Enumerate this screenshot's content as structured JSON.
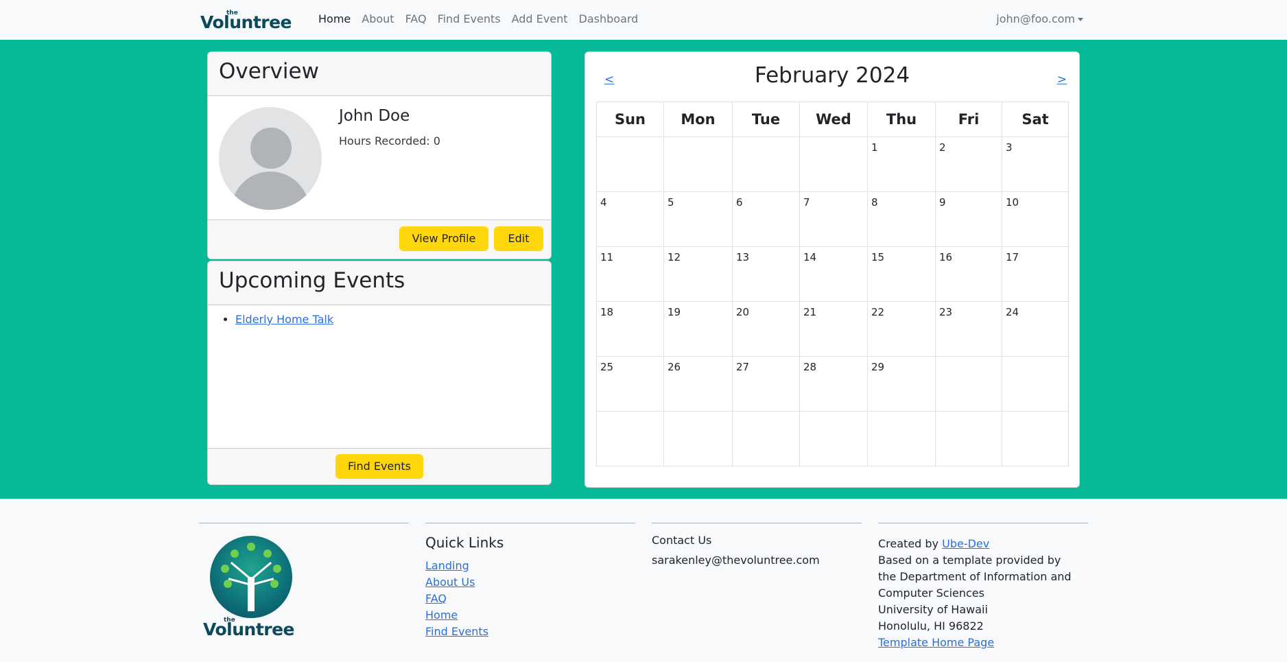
{
  "navbar": {
    "brand_the": "the",
    "brand_word": "Voluntree",
    "links": [
      "Home",
      "About",
      "FAQ",
      "Find Events",
      "Add Event",
      "Dashboard"
    ],
    "user_email": "john@foo.com"
  },
  "overview": {
    "title": "Overview",
    "name": "John Doe",
    "hours": "Hours Recorded: 0",
    "view_profile_label": "View Profile",
    "edit_label": "Edit"
  },
  "upcoming": {
    "title": "Upcoming Events",
    "events": [
      "Elderly Home Talk"
    ],
    "find_events_label": "Find Events"
  },
  "calendar": {
    "title": "February 2024",
    "prev_label": "<",
    "next_label": ">",
    "weekdays": [
      "Sun",
      "Mon",
      "Tue",
      "Wed",
      "Thu",
      "Fri",
      "Sat"
    ],
    "weeks": [
      [
        "",
        "",
        "",
        "",
        "1",
        "2",
        "3"
      ],
      [
        "4",
        "5",
        "6",
        "7",
        "8",
        "9",
        "10"
      ],
      [
        "11",
        "12",
        "13",
        "14",
        "15",
        "16",
        "17"
      ],
      [
        "18",
        "19",
        "20",
        "21",
        "22",
        "23",
        "24"
      ],
      [
        "25",
        "26",
        "27",
        "28",
        "29",
        "",
        ""
      ],
      [
        "",
        "",
        "",
        "",
        "",
        "",
        ""
      ]
    ]
  },
  "footer": {
    "logo_the": "the",
    "logo_word": "Voluntree",
    "quick_links_heading": "Quick Links",
    "quick_links": [
      "Landing",
      "About Us",
      "FAQ",
      "Home",
      "Find Events"
    ],
    "contact_heading": "Contact Us",
    "contact_email": "sarakenley@thevoluntree.com",
    "created_by_prefix": "Created by ",
    "created_by_link": "Ube-Dev",
    "credits_lines": [
      "Based on a template provided by",
      "the Department of Information and",
      "Computer Sciences",
      "University of Hawaii",
      "Honolulu, HI 96822"
    ],
    "template_link": "Template Home Page"
  },
  "colors": {
    "brand_green": "#06ba98",
    "button_yellow": "#ffd60a",
    "link_blue": "#2a6fdb",
    "brand_dark": "#0b4a5a"
  }
}
